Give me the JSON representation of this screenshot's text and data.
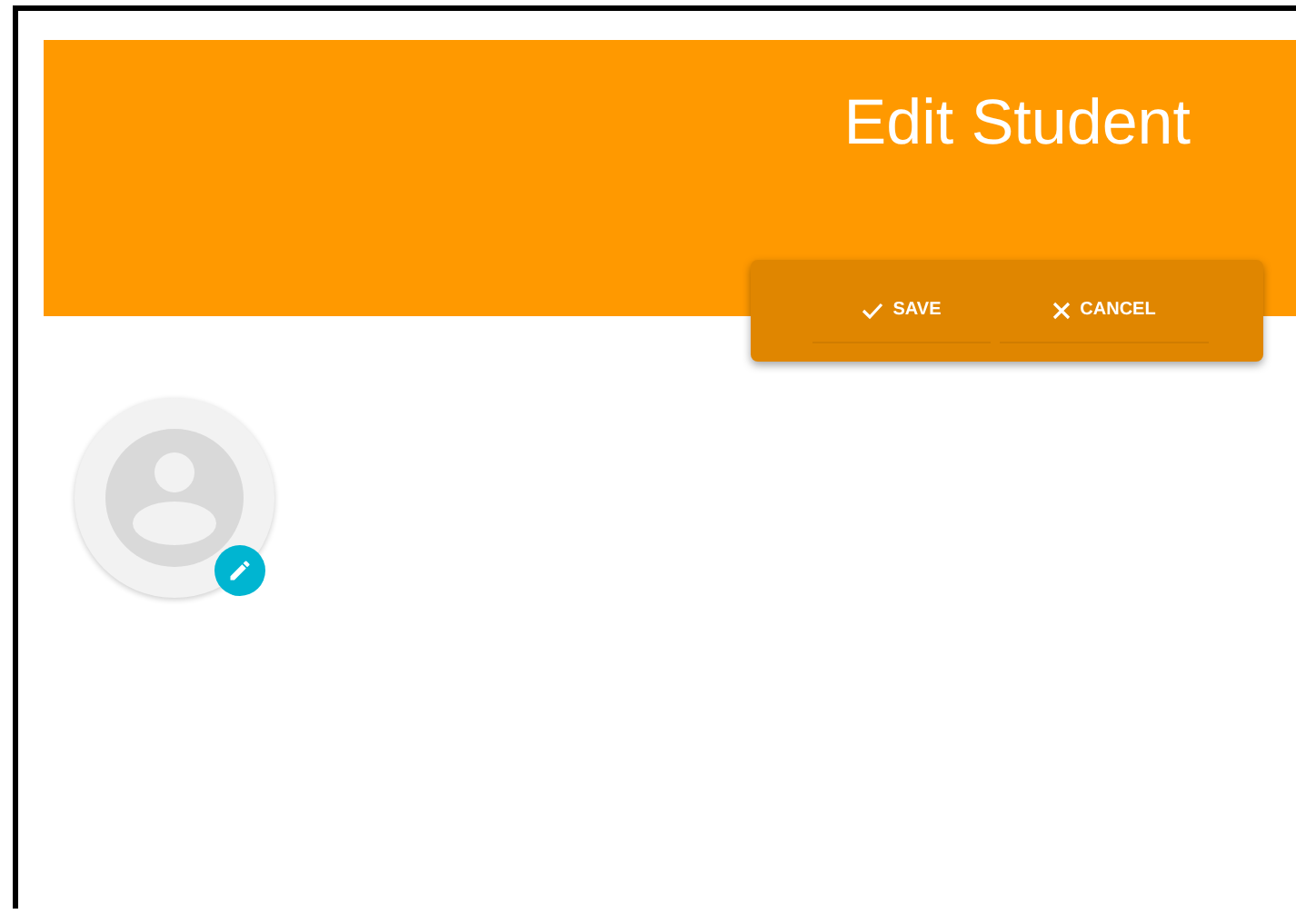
{
  "header": {
    "title": "Edit Student"
  },
  "actions": [
    {
      "kind": "save",
      "label": "SAVE"
    },
    {
      "kind": "cancel",
      "label": "CANCEL"
    }
  ]
}
